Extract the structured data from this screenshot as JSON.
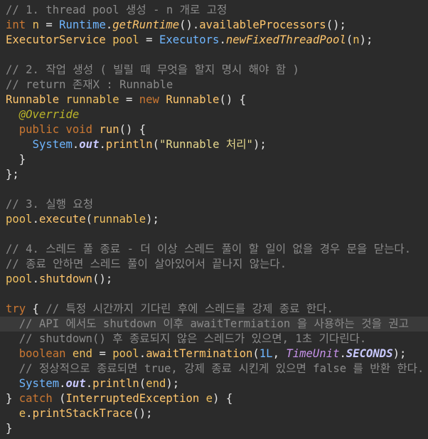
{
  "code_lines": [
    {
      "highlight": false,
      "tokens": [
        {
          "t": "// 1. thread pool 생성 - n 개로 고정",
          "c": "cm"
        }
      ]
    },
    {
      "highlight": false,
      "tokens": [
        {
          "t": "int",
          "c": "kw"
        },
        {
          "t": " ",
          "c": "pl"
        },
        {
          "t": "n",
          "c": "id"
        },
        {
          "t": " = ",
          "c": "pl"
        },
        {
          "t": "Runtime",
          "c": "cls"
        },
        {
          "t": ".",
          "c": "pl"
        },
        {
          "t": "getRuntime",
          "c": "ifn"
        },
        {
          "t": "().",
          "c": "pl"
        },
        {
          "t": "availableProcessors",
          "c": "fn"
        },
        {
          "t": "();",
          "c": "pl"
        }
      ]
    },
    {
      "highlight": false,
      "tokens": [
        {
          "t": "ExecutorService",
          "c": "ty"
        },
        {
          "t": " ",
          "c": "pl"
        },
        {
          "t": "pool",
          "c": "id"
        },
        {
          "t": " = ",
          "c": "pl"
        },
        {
          "t": "Executors",
          "c": "cls"
        },
        {
          "t": ".",
          "c": "pl"
        },
        {
          "t": "newFixedThreadPool",
          "c": "ifn"
        },
        {
          "t": "(",
          "c": "pl"
        },
        {
          "t": "n",
          "c": "id"
        },
        {
          "t": ");",
          "c": "pl"
        }
      ]
    },
    {
      "highlight": false,
      "tokens": []
    },
    {
      "highlight": false,
      "tokens": [
        {
          "t": "// 2. 작업 생성 ( 빌릴 때 무엇을 할지 명시 해야 함 )",
          "c": "cm"
        }
      ]
    },
    {
      "highlight": false,
      "tokens": [
        {
          "t": "// return 존재X : Runnable",
          "c": "cm"
        }
      ]
    },
    {
      "highlight": false,
      "tokens": [
        {
          "t": "Runnable",
          "c": "ty"
        },
        {
          "t": " ",
          "c": "pl"
        },
        {
          "t": "runnable",
          "c": "id"
        },
        {
          "t": " = ",
          "c": "pl"
        },
        {
          "t": "new",
          "c": "kw"
        },
        {
          "t": " ",
          "c": "pl"
        },
        {
          "t": "Runnable",
          "c": "ty"
        },
        {
          "t": "() {",
          "c": "pl"
        }
      ]
    },
    {
      "highlight": false,
      "tokens": [
        {
          "t": "  ",
          "c": "pl"
        },
        {
          "t": "@Override",
          "c": "ann"
        }
      ]
    },
    {
      "highlight": false,
      "tokens": [
        {
          "t": "  ",
          "c": "pl"
        },
        {
          "t": "public",
          "c": "kw"
        },
        {
          "t": " ",
          "c": "pl"
        },
        {
          "t": "void",
          "c": "kw"
        },
        {
          "t": " ",
          "c": "pl"
        },
        {
          "t": "run",
          "c": "fn"
        },
        {
          "t": "() {",
          "c": "pl"
        }
      ]
    },
    {
      "highlight": false,
      "tokens": [
        {
          "t": "    ",
          "c": "pl"
        },
        {
          "t": "System",
          "c": "cls"
        },
        {
          "t": ".",
          "c": "pl"
        },
        {
          "t": "out",
          "c": "fld"
        },
        {
          "t": ".",
          "c": "pl"
        },
        {
          "t": "println",
          "c": "fn"
        },
        {
          "t": "(",
          "c": "pl"
        },
        {
          "t": "\"Runnable 처리\"",
          "c": "str"
        },
        {
          "t": ");",
          "c": "pl"
        }
      ]
    },
    {
      "highlight": false,
      "tokens": [
        {
          "t": "  }",
          "c": "pl"
        }
      ]
    },
    {
      "highlight": false,
      "tokens": [
        {
          "t": "};",
          "c": "pl"
        }
      ]
    },
    {
      "highlight": false,
      "tokens": []
    },
    {
      "highlight": false,
      "tokens": [
        {
          "t": "// 3. 실행 요청",
          "c": "cm"
        }
      ]
    },
    {
      "highlight": false,
      "tokens": [
        {
          "t": "pool",
          "c": "id"
        },
        {
          "t": ".",
          "c": "pl"
        },
        {
          "t": "execute",
          "c": "fn"
        },
        {
          "t": "(",
          "c": "pl"
        },
        {
          "t": "runnable",
          "c": "id"
        },
        {
          "t": ");",
          "c": "pl"
        }
      ]
    },
    {
      "highlight": false,
      "tokens": []
    },
    {
      "highlight": false,
      "tokens": [
        {
          "t": "// 4. 스레드 풀 종료 - 더 이상 스레드 풀이 할 일이 없을 경우 문을 닫는다.",
          "c": "cm"
        }
      ]
    },
    {
      "highlight": false,
      "tokens": [
        {
          "t": "// 종료 안하면 스레드 풀이 살아있어서 끝나지 않는다.",
          "c": "cm"
        }
      ]
    },
    {
      "highlight": false,
      "tokens": [
        {
          "t": "pool",
          "c": "id"
        },
        {
          "t": ".",
          "c": "pl"
        },
        {
          "t": "shutdown",
          "c": "fn"
        },
        {
          "t": "();",
          "c": "pl"
        }
      ]
    },
    {
      "highlight": false,
      "tokens": []
    },
    {
      "highlight": false,
      "tokens": [
        {
          "t": "try",
          "c": "kw"
        },
        {
          "t": " { ",
          "c": "pl"
        },
        {
          "t": "// 특정 시간까지 기다린 후에 스레드를 강제 종료 한다.",
          "c": "cm"
        }
      ]
    },
    {
      "highlight": true,
      "tokens": [
        {
          "t": "  ",
          "c": "pl"
        },
        {
          "t": "// API 에서도 shutdown 이후 awaitTermiation 을 사용하는 것을 권고",
          "c": "cm"
        }
      ]
    },
    {
      "highlight": false,
      "tokens": [
        {
          "t": "  ",
          "c": "pl"
        },
        {
          "t": "// shutdown() 후 종료되지 않은 스레드가 있으면, 1초 기다린다.",
          "c": "cm"
        }
      ]
    },
    {
      "highlight": false,
      "tokens": [
        {
          "t": "  ",
          "c": "pl"
        },
        {
          "t": "boolean",
          "c": "kw"
        },
        {
          "t": " ",
          "c": "pl"
        },
        {
          "t": "end",
          "c": "id"
        },
        {
          "t": " = ",
          "c": "pl"
        },
        {
          "t": "pool",
          "c": "id"
        },
        {
          "t": ".",
          "c": "pl"
        },
        {
          "t": "awaitTermination",
          "c": "fn"
        },
        {
          "t": "(",
          "c": "pl"
        },
        {
          "t": "1L",
          "c": "num"
        },
        {
          "t": ", ",
          "c": "pl"
        },
        {
          "t": "TimeUnit",
          "c": "en"
        },
        {
          "t": ".",
          "c": "pl"
        },
        {
          "t": "SECONDS",
          "c": "fld"
        },
        {
          "t": ");",
          "c": "pl"
        }
      ]
    },
    {
      "highlight": false,
      "tokens": [
        {
          "t": "  ",
          "c": "pl"
        },
        {
          "t": "// 정상적으로 종료되면 true, 강제 종료 시킨게 있으면 false 를 반환 한다.",
          "c": "cm"
        }
      ]
    },
    {
      "highlight": false,
      "tokens": [
        {
          "t": "  ",
          "c": "pl"
        },
        {
          "t": "System",
          "c": "cls"
        },
        {
          "t": ".",
          "c": "pl"
        },
        {
          "t": "out",
          "c": "fld"
        },
        {
          "t": ".",
          "c": "pl"
        },
        {
          "t": "println",
          "c": "fn"
        },
        {
          "t": "(",
          "c": "pl"
        },
        {
          "t": "end",
          "c": "id"
        },
        {
          "t": ");",
          "c": "pl"
        }
      ]
    },
    {
      "highlight": false,
      "tokens": [
        {
          "t": "} ",
          "c": "pl"
        },
        {
          "t": "catch",
          "c": "kw"
        },
        {
          "t": " (",
          "c": "pl"
        },
        {
          "t": "InterruptedException",
          "c": "ty"
        },
        {
          "t": " ",
          "c": "pl"
        },
        {
          "t": "e",
          "c": "id"
        },
        {
          "t": ") {",
          "c": "pl"
        }
      ]
    },
    {
      "highlight": false,
      "tokens": [
        {
          "t": "  ",
          "c": "pl"
        },
        {
          "t": "e",
          "c": "id"
        },
        {
          "t": ".",
          "c": "pl"
        },
        {
          "t": "printStackTrace",
          "c": "fn"
        },
        {
          "t": "();",
          "c": "pl"
        }
      ]
    },
    {
      "highlight": false,
      "tokens": [
        {
          "t": "}",
          "c": "pl"
        }
      ]
    }
  ]
}
